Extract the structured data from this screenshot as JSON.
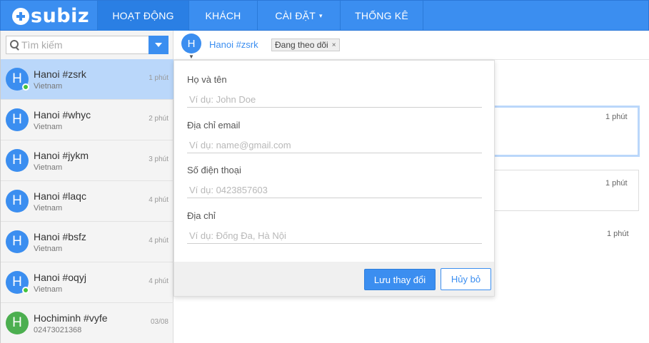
{
  "brand": {
    "logo_text": "subiz"
  },
  "nav": {
    "items": [
      {
        "label": "HOẠT ĐỘNG",
        "active": true
      },
      {
        "label": "KHÁCH",
        "active": false
      },
      {
        "label": "CÀI ĐẶT",
        "active": false,
        "dropdown": true
      },
      {
        "label": "THỐNG KÊ",
        "active": false
      }
    ],
    "dropdown_chevron": "▾"
  },
  "search": {
    "placeholder": "Tìm kiếm"
  },
  "conversations": [
    {
      "avatar": "H",
      "name": "Hanoi #zsrk",
      "sub": "Vietnam",
      "time": "1 phút",
      "online": true,
      "selected": true
    },
    {
      "avatar": "H",
      "name": "Hanoi #whyc",
      "sub": "Vietnam",
      "time": "2 phút",
      "online": false
    },
    {
      "avatar": "H",
      "name": "Hanoi #jykm",
      "sub": "Vietnam",
      "time": "3 phút",
      "online": false
    },
    {
      "avatar": "H",
      "name": "Hanoi #laqc",
      "sub": "Vietnam",
      "time": "4 phút",
      "online": false
    },
    {
      "avatar": "H",
      "name": "Hanoi #bsfz",
      "sub": "Vietnam",
      "time": "4 phút",
      "online": false
    },
    {
      "avatar": "H",
      "name": "Hanoi #oqyj",
      "sub": "Vietnam",
      "time": "4 phút",
      "online": true
    },
    {
      "avatar": "H",
      "name": "Hochiminh #vyfe",
      "sub": "02473021368",
      "time": "03/08",
      "online": false,
      "avatar_color": "#4caf50"
    }
  ],
  "header": {
    "avatar": "H",
    "name": "Hanoi #zsrk",
    "tag": "Đang theo dõi",
    "tag_close": "×"
  },
  "messages": [
    {
      "time": "1 phút"
    },
    {
      "time": "1 phút"
    },
    {
      "time": "1 phút"
    }
  ],
  "form": {
    "fields": [
      {
        "label": "Họ và tên",
        "placeholder": "Ví dụ: John Doe",
        "value": ""
      },
      {
        "label": "Địa chỉ email",
        "placeholder": "Ví dụ: name@gmail.com",
        "value": ""
      },
      {
        "label": "Số điện thoại",
        "placeholder": "Ví dụ: 0423857603",
        "value": ""
      },
      {
        "label": "Địa chỉ",
        "placeholder": "Ví dụ: Đống Đa, Hà Nội",
        "value": ""
      }
    ],
    "save_label": "Lưu thay đổi",
    "cancel_label": "Hủy bỏ"
  },
  "colors": {
    "primary": "#3b8ef0",
    "selected_row": "#bad7fa",
    "online": "#44c23c",
    "alt_avatar": "#4caf50"
  }
}
